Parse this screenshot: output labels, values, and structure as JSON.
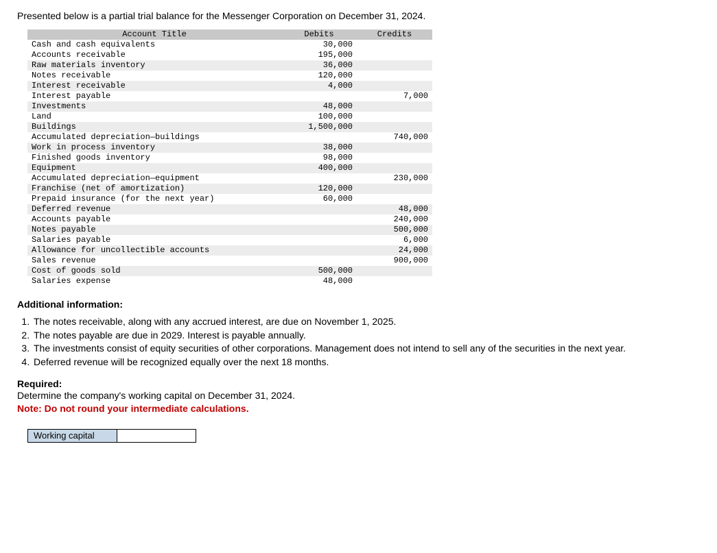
{
  "intro": "Presented below is a partial trial balance for the Messenger Corporation on December 31, 2024.",
  "table": {
    "headers": {
      "title": "Account Title",
      "debits": "Debits",
      "credits": "Credits"
    },
    "rows": [
      {
        "title": "Cash and cash equivalents",
        "debit": "30,000",
        "credit": "",
        "shaded": false
      },
      {
        "title": "Accounts receivable",
        "debit": "195,000",
        "credit": "",
        "shaded": false
      },
      {
        "title": "Raw materials inventory",
        "debit": "36,000",
        "credit": "",
        "shaded": true
      },
      {
        "title": "Notes receivable",
        "debit": "120,000",
        "credit": "",
        "shaded": false
      },
      {
        "title": "Interest receivable",
        "debit": "4,000",
        "credit": "",
        "shaded": true
      },
      {
        "title": "Interest payable",
        "debit": "",
        "credit": "7,000",
        "shaded": false
      },
      {
        "title": "Investments",
        "debit": "48,000",
        "credit": "",
        "shaded": true
      },
      {
        "title": "Land",
        "debit": "100,000",
        "credit": "",
        "shaded": false
      },
      {
        "title": "Buildings",
        "debit": "1,500,000",
        "credit": "",
        "shaded": true
      },
      {
        "title": "Accumulated depreciation—buildings",
        "debit": "",
        "credit": "740,000",
        "shaded": false
      },
      {
        "title": "Work in process inventory",
        "debit": "38,000",
        "credit": "",
        "shaded": true
      },
      {
        "title": "Finished goods inventory",
        "debit": "98,000",
        "credit": "",
        "shaded": false
      },
      {
        "title": "Equipment",
        "debit": "400,000",
        "credit": "",
        "shaded": true
      },
      {
        "title": "Accumulated depreciation—equipment",
        "debit": "",
        "credit": "230,000",
        "shaded": false
      },
      {
        "title": "Franchise (net of amortization)",
        "debit": "120,000",
        "credit": "",
        "shaded": true
      },
      {
        "title": "Prepaid insurance (for the next year)",
        "debit": "60,000",
        "credit": "",
        "shaded": false
      },
      {
        "title": "Deferred revenue",
        "debit": "",
        "credit": "48,000",
        "shaded": true
      },
      {
        "title": "Accounts payable",
        "debit": "",
        "credit": "240,000",
        "shaded": false
      },
      {
        "title": "Notes payable",
        "debit": "",
        "credit": "500,000",
        "shaded": true
      },
      {
        "title": "Salaries payable",
        "debit": "",
        "credit": "6,000",
        "shaded": false
      },
      {
        "title": "Allowance for uncollectible accounts",
        "debit": "",
        "credit": "24,000",
        "shaded": true
      },
      {
        "title": "Sales revenue",
        "debit": "",
        "credit": "900,000",
        "shaded": false
      },
      {
        "title": "Cost of goods sold",
        "debit": "500,000",
        "credit": "",
        "shaded": true
      },
      {
        "title": "Salaries expense",
        "debit": "48,000",
        "credit": "",
        "shaded": false
      }
    ]
  },
  "additionalInfoHeading": "Additional information:",
  "additionalInfo": [
    "The notes receivable, along with any accrued interest, are due on November 1, 2025.",
    "The notes payable are due in 2029. Interest is payable annually.",
    "The investments consist of equity securities of other corporations. Management does not intend to sell any of the securities in the next year.",
    "Deferred revenue will be recognized equally over the next 18 months."
  ],
  "requiredHeading": "Required:",
  "requiredText": "Determine the company's working capital on December 31, 2024.",
  "noteText": "Note: Do not round your intermediate calculations.",
  "answer": {
    "label": "Working capital",
    "value": ""
  }
}
